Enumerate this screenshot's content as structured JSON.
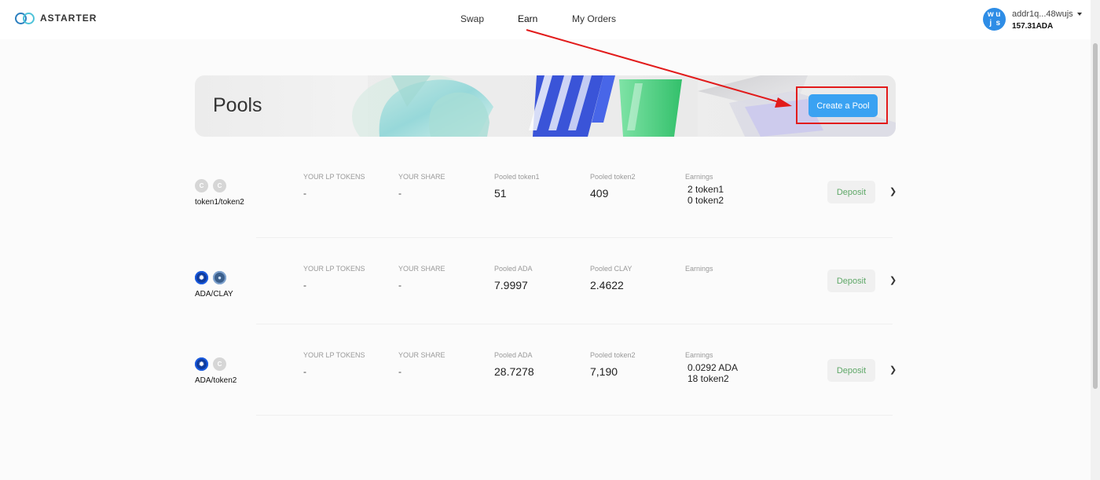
{
  "header": {
    "brand": "ASTARTER",
    "nav": [
      {
        "label": "Swap",
        "active": false
      },
      {
        "label": "Earn",
        "active": true
      },
      {
        "label": "My Orders",
        "active": false
      }
    ],
    "account": {
      "avatar_letters": [
        "w",
        "u",
        "j",
        "s"
      ],
      "address": "addr1q...48wujs",
      "balance": "157.31ADA"
    }
  },
  "banner": {
    "title": "Pools",
    "create_button": "Create a Pool"
  },
  "pools": [
    {
      "pair": "token1/token2",
      "token_icons": [
        "generic",
        "generic"
      ],
      "lp_label": "YOUR LP TOKENS",
      "lp_value": "-",
      "share_label": "YOUR SHARE",
      "share_value": "-",
      "pooled1_label": "Pooled token1",
      "pooled1_value": "51",
      "pooled2_label": "Pooled token2",
      "pooled2_value": "409",
      "earnings_label": "Earnings",
      "earnings": [
        "2 token1",
        "0 token2"
      ],
      "deposit": "Deposit"
    },
    {
      "pair": "ADA/CLAY",
      "token_icons": [
        "ada",
        "clay"
      ],
      "lp_label": "YOUR LP TOKENS",
      "lp_value": "-",
      "share_label": "YOUR SHARE",
      "share_value": "-",
      "pooled1_label": "Pooled ADA",
      "pooled1_value": "7.9997",
      "pooled2_label": "Pooled CLAY",
      "pooled2_value": "2.4622",
      "earnings_label": "Earnings",
      "earnings": [],
      "deposit": "Deposit"
    },
    {
      "pair": "ADA/token2",
      "token_icons": [
        "ada",
        "generic"
      ],
      "lp_label": "YOUR LP TOKENS",
      "lp_value": "-",
      "share_label": "YOUR SHARE",
      "share_value": "-",
      "pooled1_label": "Pooled ADA",
      "pooled1_value": "28.7278",
      "pooled2_label": "Pooled token2",
      "pooled2_value": "7,190",
      "earnings_label": "Earnings",
      "earnings": [
        "0.0292 ADA",
        "18 token2"
      ],
      "deposit": "Deposit"
    }
  ],
  "colors": {
    "accent_button": "#3aa2f2",
    "deposit_text": "#5fa868",
    "annotation_red": "#e21b1b"
  }
}
